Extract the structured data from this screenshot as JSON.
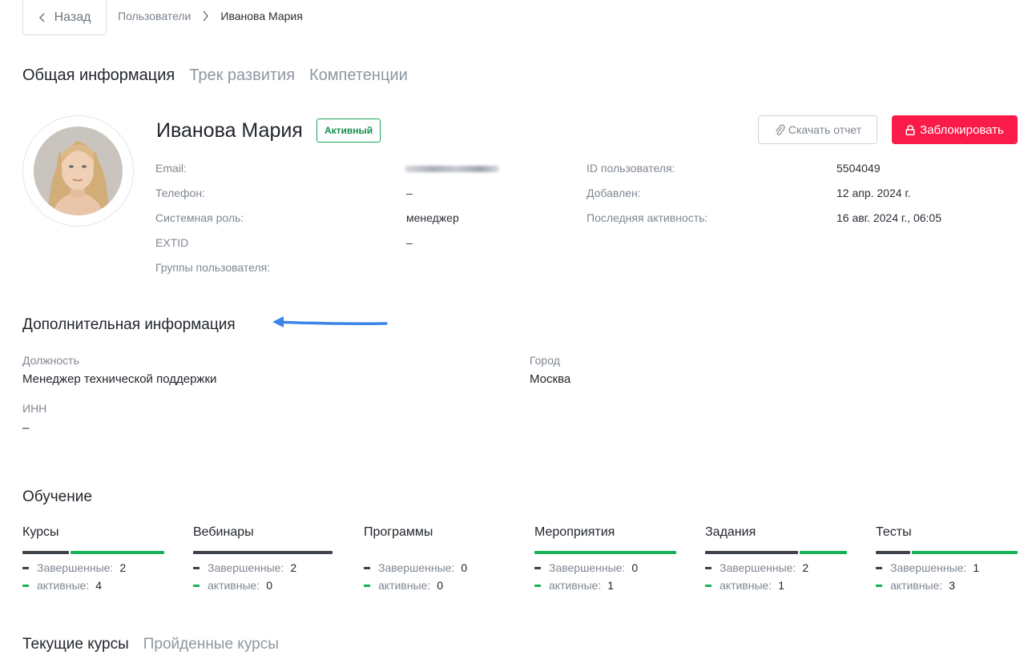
{
  "nav": {
    "back_label": "Назад",
    "breadcrumb": {
      "parent": "Пользователи",
      "current": "Иванова Мария"
    }
  },
  "tabs": [
    {
      "label": "Общая информация",
      "active": true
    },
    {
      "label": "Трек развития",
      "active": false
    },
    {
      "label": "Компетенции",
      "active": false
    }
  ],
  "profile": {
    "name": "Иванова Мария",
    "status": "Активный",
    "report_button": "Скачать отчет",
    "block_button": "Заблокировать",
    "left_info": [
      {
        "label": "Email:",
        "value": ""
      },
      {
        "label": "Телефон:",
        "value": "–"
      },
      {
        "label": "Системная роль:",
        "value": "менеджер"
      },
      {
        "label": "EXTID",
        "value": "–"
      },
      {
        "label": "Группы пользователя:",
        "value": ""
      }
    ],
    "right_info": [
      {
        "label": "ID пользователя:",
        "value": "5504049"
      },
      {
        "label": "Добавлен:",
        "value": "12 апр. 2024 г."
      },
      {
        "label": "Последняя активность:",
        "value": "16 авг. 2024 г., 06:05"
      }
    ]
  },
  "additional": {
    "title": "Дополнительная информация",
    "position_label": "Должность",
    "position_value": "Менеджер технической поддержки",
    "city_label": "Город",
    "city_value": "Москва",
    "inn_label": "ИНН",
    "inn_value": "–"
  },
  "learning": {
    "title": "Обучение",
    "completed_label": "Завершенные:",
    "active_label": "активные:",
    "categories": [
      {
        "title": "Курсы",
        "completed": "2",
        "active": "4"
      },
      {
        "title": "Вебинары",
        "completed": "2",
        "active": "0"
      },
      {
        "title": "Программы",
        "completed": "0",
        "active": "0"
      },
      {
        "title": "Мероприятия",
        "completed": "0",
        "active": "1"
      },
      {
        "title": "Задания",
        "completed": "2",
        "active": "1"
      },
      {
        "title": "Тесты",
        "completed": "1",
        "active": "3"
      }
    ]
  },
  "course_tabs": [
    {
      "label": "Текущие курсы",
      "active": true
    },
    {
      "label": "Пройденные курсы",
      "active": false
    }
  ],
  "colors": {
    "accent_green": "#18b157",
    "danger": "#fb1b4a",
    "bar_dark": "#3e434c",
    "annotation_arrow": "#3b86e8"
  }
}
